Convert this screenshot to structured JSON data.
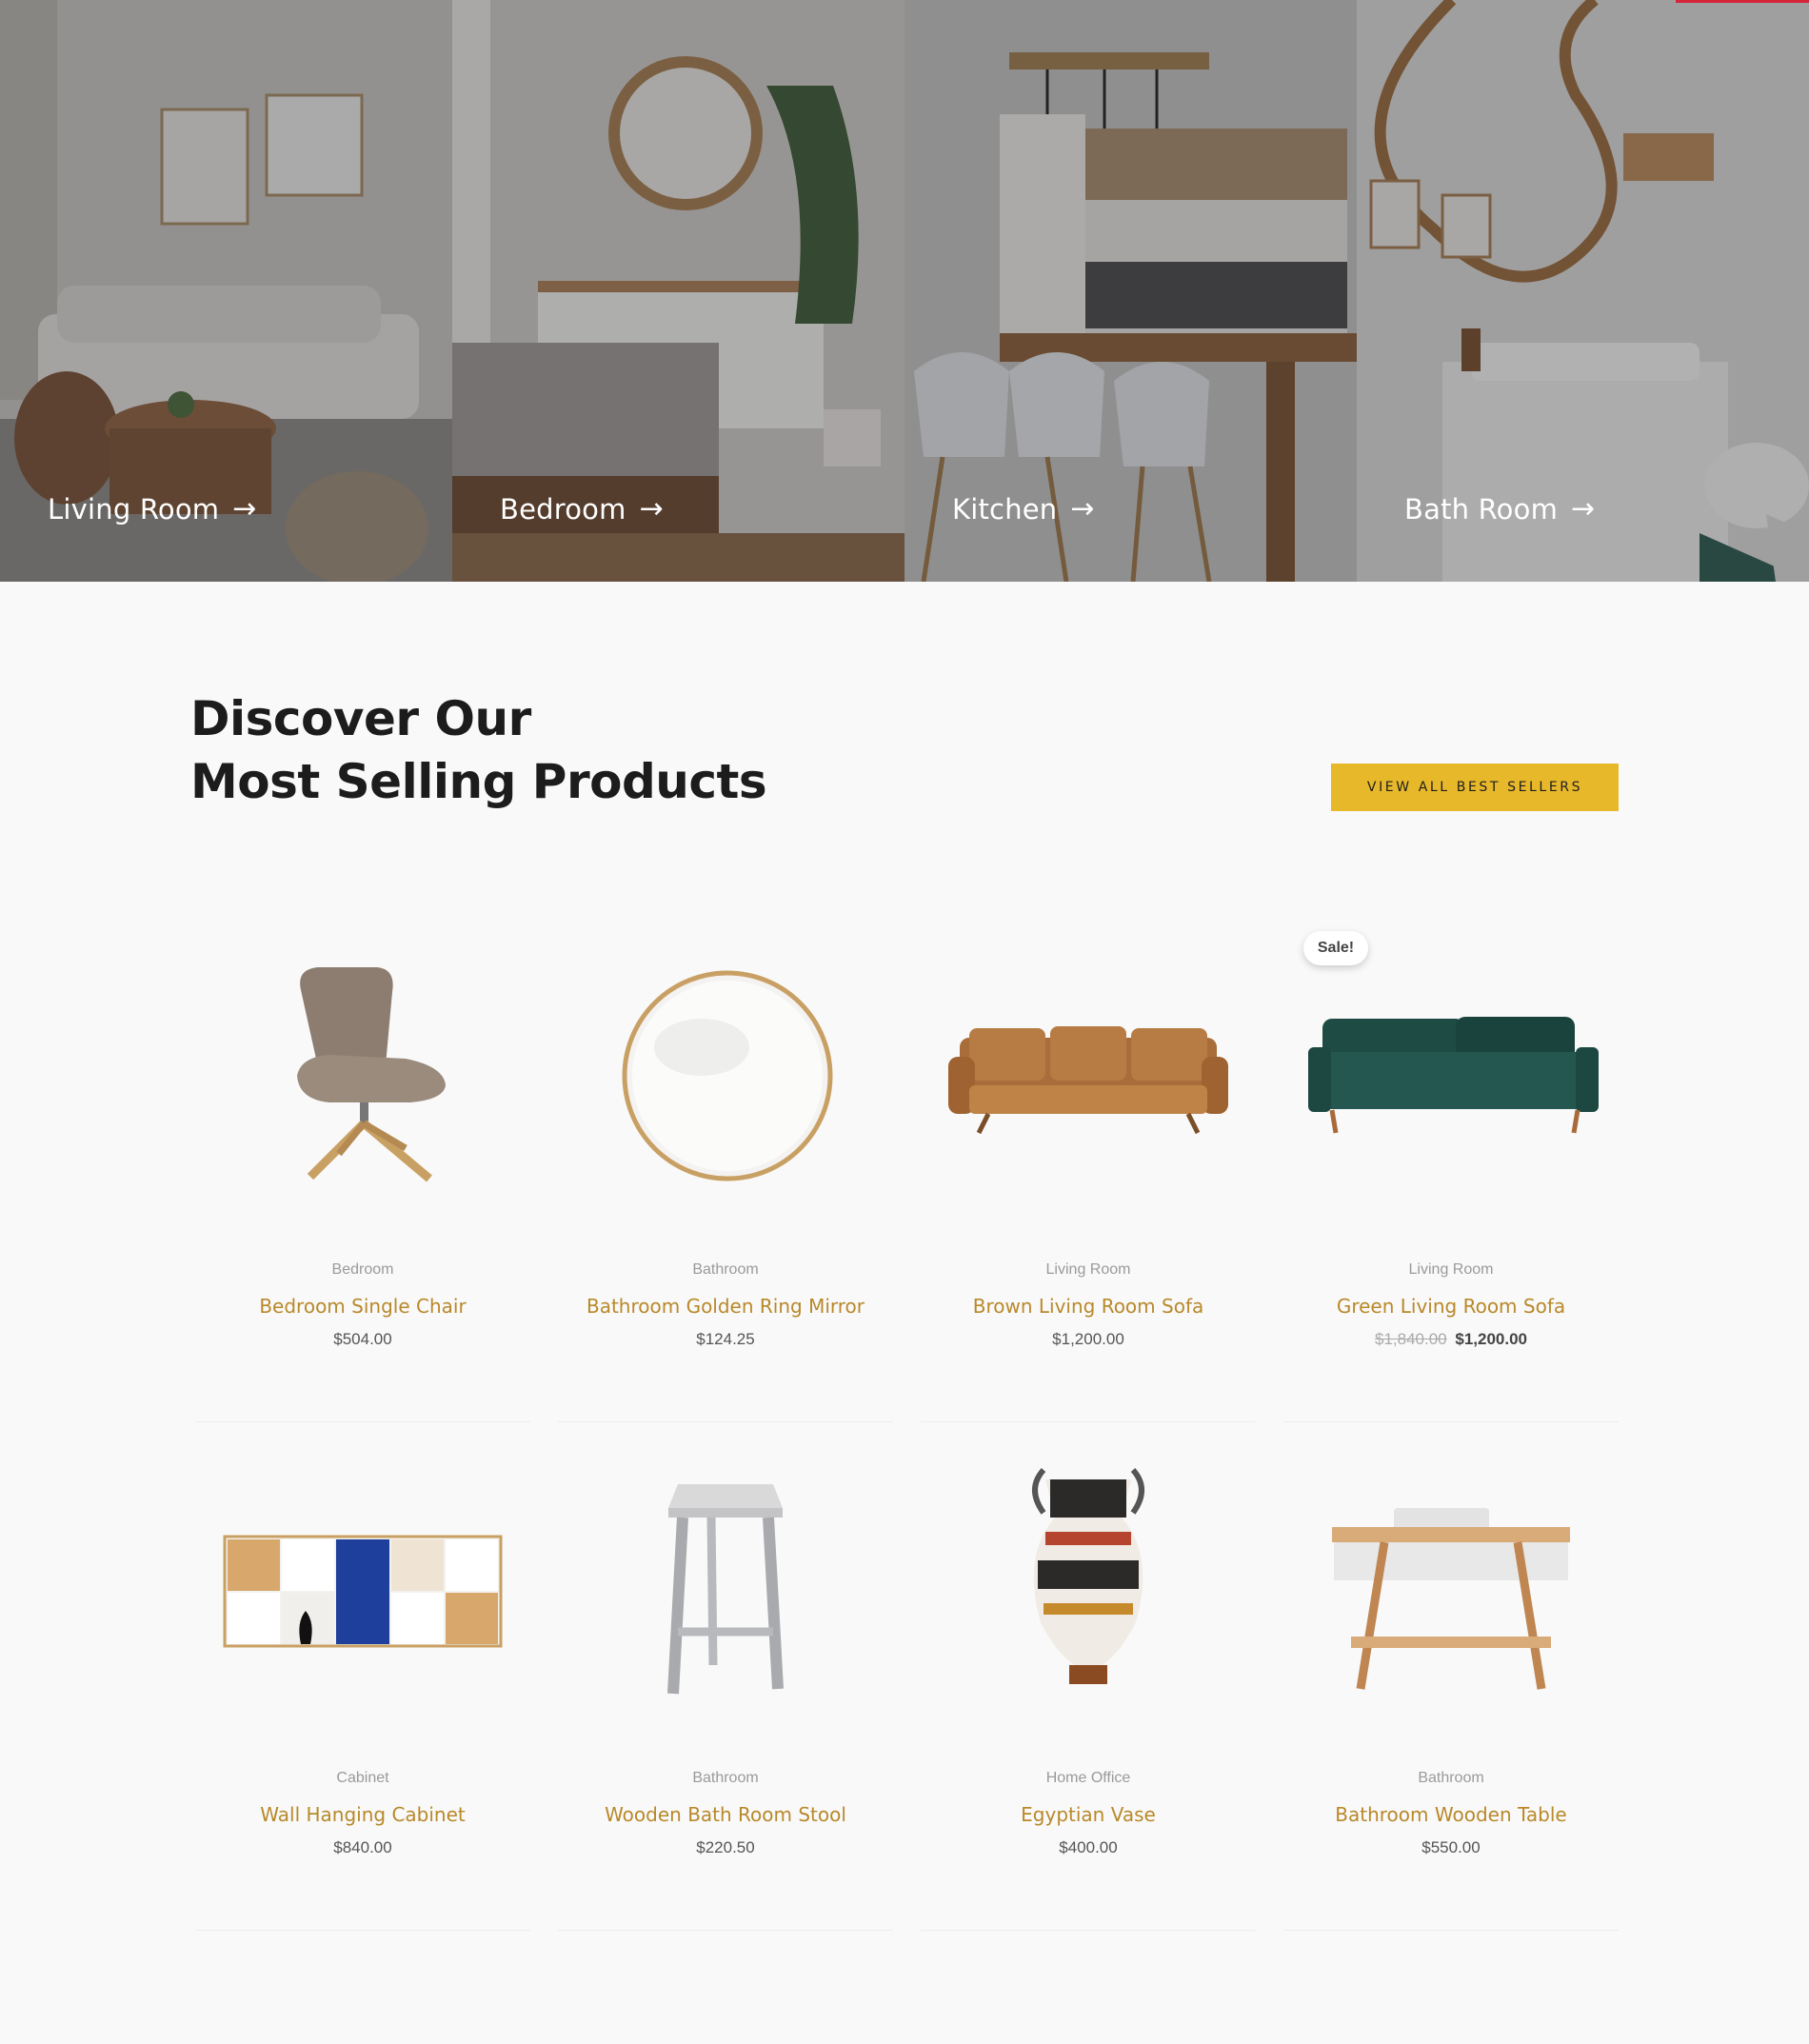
{
  "categories": [
    {
      "label": "Living Room",
      "arrow": "→"
    },
    {
      "label": "Bedroom",
      "arrow": "→"
    },
    {
      "label": "Kitchen",
      "arrow": "→"
    },
    {
      "label": "Bath Room",
      "arrow": "→"
    }
  ],
  "section": {
    "heading_line1": "Discover Our",
    "heading_line2": "Most Selling Products",
    "view_all_label": "VIEW ALL BEST SELLERS"
  },
  "sale_badge": "Sale!",
  "products": [
    {
      "category": "Bedroom",
      "title": "Bedroom Single Chair",
      "price": "$504.00"
    },
    {
      "category": "Bathroom",
      "title": "Bathroom Golden Ring Mirror",
      "price": "$124.25"
    },
    {
      "category": "Living Room",
      "title": "Brown Living Room Sofa",
      "price": "$1,200.00"
    },
    {
      "category": "Living Room",
      "title": "Green Living Room Sofa",
      "old_price": "$1,840.00",
      "price": "$1,200.00"
    },
    {
      "category": "Cabinet",
      "title": "Wall Hanging Cabinet",
      "price": "$840.00"
    },
    {
      "category": "Bathroom",
      "title": "Wooden Bath Room Stool",
      "price": "$220.50"
    },
    {
      "category": "Home Office",
      "title": "Egyptian Vase",
      "price": "$400.00"
    },
    {
      "category": "Bathroom",
      "title": "Bathroom Wooden Table",
      "price": "$550.00"
    }
  ],
  "colors": {
    "accent": "#e8b82b",
    "title": "#b8892a",
    "red_line": "#d4253a"
  }
}
